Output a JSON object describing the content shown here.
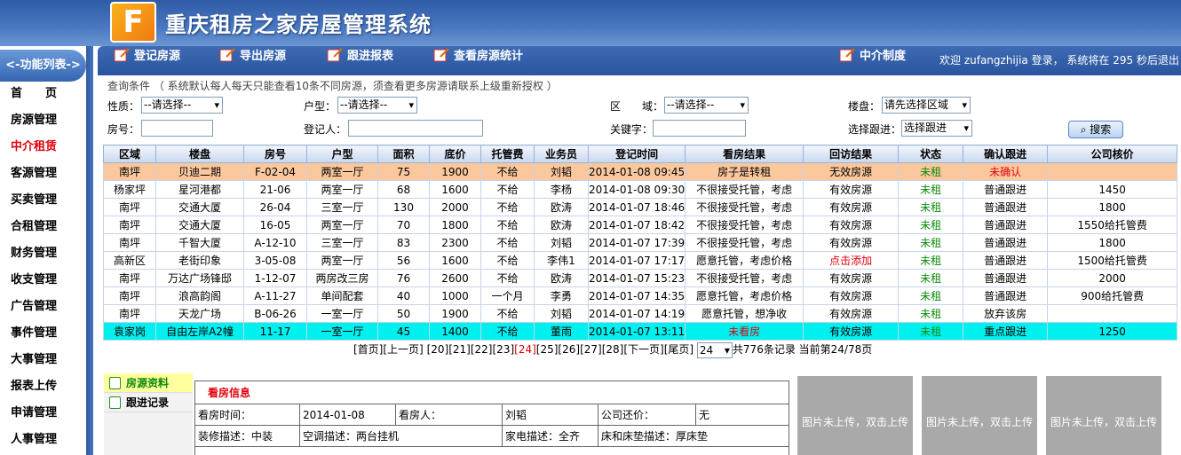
{
  "app": {
    "logo_text": "F",
    "title": "重庆租房之家房屋管理系统"
  },
  "menu": {
    "header": "<-功能列表->",
    "items": [
      {
        "label": "首　　页",
        "active": false
      },
      {
        "label": "房源管理",
        "active": false
      },
      {
        "label": "中介租赁",
        "active": true
      },
      {
        "label": "客源管理",
        "active": false
      },
      {
        "label": "买卖管理",
        "active": false
      },
      {
        "label": "合租管理",
        "active": false
      },
      {
        "label": "财务管理",
        "active": false
      },
      {
        "label": "收支管理",
        "active": false
      },
      {
        "label": "广告管理",
        "active": false
      },
      {
        "label": "事件管理",
        "active": false
      },
      {
        "label": "大事管理",
        "active": false
      },
      {
        "label": "报表上传",
        "active": false
      },
      {
        "label": "申请管理",
        "active": false
      },
      {
        "label": "人事管理",
        "active": false
      }
    ]
  },
  "toolbar": {
    "register": "登记房源",
    "export": "导出房源",
    "followup_report": "跟进报表",
    "view_stats": "查看房源统计",
    "agency_rules": "中介制度",
    "welcome": "欢迎 zufangzhijia 登录， 系统将在 295 秒后退出"
  },
  "query": {
    "note": "查询条件 （ 系统默认每人每天只能查看10条不同房源，须查看更多房源请联系上级重新授权 ）",
    "nature_label": "性质：",
    "nature_value": "--请选择--",
    "layout_label": "户型：",
    "layout_value": "--请选择--",
    "district_label": "区　　域：",
    "district_value": "--请选择--",
    "building_label": "楼盘：",
    "building_value": "请先选择区域",
    "room_label": "房号：",
    "registrant_label": "登记人：",
    "keyword_label": "关键字：",
    "follow_label": "选择跟进：",
    "follow_value": "选择跟进",
    "search_button": "搜索"
  },
  "colors": {
    "header": "#3e6bb4",
    "selected_row": "#fbc89e",
    "current_row": "#00f0f0",
    "status_green": "#0a8a0a",
    "alert_red": "#e0000b"
  },
  "table": {
    "columns": [
      "区域",
      "楼盘",
      "房号",
      "户型",
      "面积",
      "底价",
      "托管费",
      "业务员",
      "登记时间",
      "看房结果",
      "回访结果",
      "状态",
      "确认跟进",
      "公司核价"
    ],
    "rows": [
      {
        "style": "sel",
        "cells": [
          "南坪",
          "贝迪二期",
          "F-02-04",
          "两室一厅",
          "75",
          "1900",
          "不给",
          "刘韬",
          "2014-01-08 09:45",
          "房子是转租",
          "无效房源",
          "未租",
          "未确认",
          ""
        ]
      },
      {
        "style": "",
        "cells": [
          "杨家坪",
          "星河港都",
          "21-06",
          "两室一厅",
          "68",
          "1600",
          "不给",
          "李杨",
          "2014-01-08 09:30",
          "不很接受托管，考虑",
          "有效房源",
          "未租",
          "普通跟进",
          "1450"
        ]
      },
      {
        "style": "",
        "cells": [
          "南坪",
          "交通大厦",
          "26-04",
          "三室一厅",
          "130",
          "2000",
          "不给",
          "欧涛",
          "2014-01-07 18:46",
          "不很接受托管，考虑",
          "有效房源",
          "未租",
          "普通跟进",
          "1800"
        ]
      },
      {
        "style": "",
        "cells": [
          "南坪",
          "交通大厦",
          "16-05",
          "两室一厅",
          "70",
          "1800",
          "不给",
          "欧涛",
          "2014-01-07 18:42",
          "不很接受托管，考虑",
          "有效房源",
          "未租",
          "普通跟进",
          "1550给托管费"
        ]
      },
      {
        "style": "",
        "cells": [
          "南坪",
          "千智大厦",
          "A-12-10",
          "三室一厅",
          "83",
          "2300",
          "不给",
          "刘韬",
          "2014-01-07 17:39",
          "不很接受托管，考虑",
          "有效房源",
          "未租",
          "普通跟进",
          "1800"
        ]
      },
      {
        "style": "",
        "cells": [
          "高新区",
          "老街印象",
          "3-05-08",
          "两室一厅",
          "56",
          "1600",
          "不给",
          "李伟1",
          "2014-01-07 17:17",
          "愿意托管，考虑价格",
          "点击添加",
          "未租",
          "普通跟进",
          "1500给托管费"
        ]
      },
      {
        "style": "",
        "cells": [
          "南坪",
          "万达广场锋邸",
          "1-12-07",
          "两房改三房",
          "76",
          "2600",
          "不给",
          "欧涛",
          "2014-01-07 15:23",
          "不很接受托管，考虑",
          "有效房源",
          "未租",
          "普通跟进",
          "2000"
        ]
      },
      {
        "style": "",
        "cells": [
          "南坪",
          "浪高韵阁",
          "A-11-27",
          "单间配套",
          "40",
          "1000",
          "一个月",
          "李勇",
          "2014-01-07 14:35",
          "愿意托管，考虑价格",
          "有效房源",
          "未租",
          "普通跟进",
          "900给托管费"
        ]
      },
      {
        "style": "",
        "cells": [
          "南坪",
          "天龙广场",
          "B-06-26",
          "一室一厅",
          "50",
          "1900",
          "不给",
          "刘韬",
          "2014-01-07 14:19",
          "愿意托管，想净收",
          "有效房源",
          "未租",
          "放弃该房",
          ""
        ]
      },
      {
        "style": "cur",
        "cells": [
          "袁家岗",
          "自由左岸A2幢",
          "11-17",
          "一室一厅",
          "45",
          "1400",
          "不给",
          "董雨",
          "2014-01-07 13:11",
          "未看房",
          "有效房源",
          "未租",
          "重点跟进",
          "1250"
        ]
      }
    ]
  },
  "pager": {
    "first": "[首页]",
    "prev": "[上一页]",
    "pages": [
      "[20]",
      "[21]",
      "[22]",
      "[23]",
      "[24]",
      "[25]",
      "[26]",
      "[27]",
      "[28]"
    ],
    "current_page_label": "[24]",
    "next": "[下一页]",
    "last": "[尾页]",
    "select_value": "24",
    "summary": "共776条记录  当前第24/78页"
  },
  "tabs": [
    "房源资料",
    "跟进记录"
  ],
  "detail": {
    "title": "看房信息",
    "view_time_label": "看房时间：",
    "view_time": "2014-01-08",
    "viewer_label": "看房人：",
    "viewer": "刘韬",
    "company_price_label": "公司还价：",
    "company_price": "无",
    "decoration": "装修描述：中装",
    "aircon": "空调描述：两台挂机",
    "appliance": "家电描述：全齐",
    "bed": "床和床垫描述：厚床垫"
  },
  "photos": {
    "placeholder": "图片未上传，双击上传图片"
  }
}
